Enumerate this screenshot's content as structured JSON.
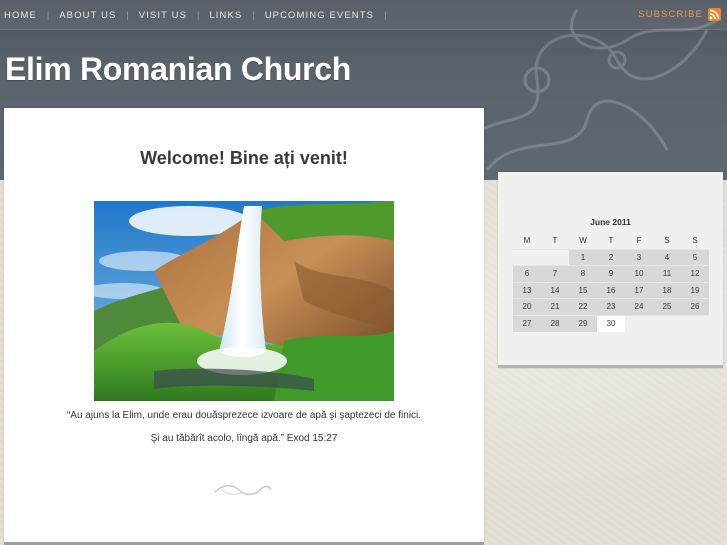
{
  "nav": {
    "links": [
      "HOME",
      "ABOUT US",
      "VISIT US",
      "LINKS",
      "UPCOMING EVENTS"
    ],
    "separator": "|",
    "subscribe_label": "SUBSCRIBE"
  },
  "site": {
    "title": "Elim Romanian Church"
  },
  "main": {
    "welcome": "Welcome! Bine ați venit!",
    "quote_line1": "“Au ajuns la Elim, unde erau douăsprezece izvoare de apă şi şaptezeci de finici.",
    "quote_line2": "Şi au tăbărît acolo, lîngă apă.” Exod 15:27"
  },
  "calendar": {
    "title": "June 2011",
    "weekdays": [
      "M",
      "T",
      "W",
      "T",
      "F",
      "S",
      "S"
    ],
    "weeks": [
      [
        "",
        "",
        "1",
        "2",
        "3",
        "4",
        "5"
      ],
      [
        "6",
        "7",
        "8",
        "9",
        "10",
        "11",
        "12"
      ],
      [
        "13",
        "14",
        "15",
        "16",
        "17",
        "18",
        "19"
      ],
      [
        "20",
        "21",
        "22",
        "23",
        "24",
        "25",
        "26"
      ],
      [
        "27",
        "28",
        "29",
        "30",
        "",
        "",
        ""
      ]
    ],
    "today": "30"
  },
  "colors": {
    "header_bg": "#555e67",
    "subscribe_accent": "#e59a44",
    "rss_orange": "#e8872b",
    "calendar_day_bg": "#d8d8d8"
  },
  "icons": [
    "rss-icon",
    "flourish-ornament"
  ]
}
